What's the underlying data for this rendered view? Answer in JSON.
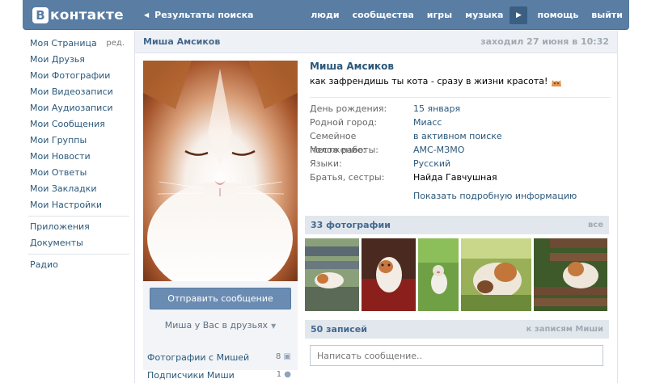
{
  "header": {
    "logo_letter": "В",
    "logo_text": "контакте",
    "back_link": "Результаты поиска",
    "nav": [
      "люди",
      "сообщества",
      "игры",
      "музыка"
    ],
    "nav_after_play": [
      "помощь",
      "выйти"
    ]
  },
  "sidebar": {
    "edit": "ред.",
    "items": [
      "Моя Страница",
      "Мои Друзья",
      "Мои Фотографии",
      "Мои Видеозаписи",
      "Мои Аудиозаписи",
      "Мои Сообщения",
      "Мои Группы",
      "Мои Новости",
      "Мои Ответы",
      "Мои Закладки",
      "Мои Настройки"
    ],
    "extra": [
      "Приложения",
      "Документы"
    ],
    "bottom": [
      "Радио"
    ]
  },
  "profile": {
    "header_name": "Миша Амсиков",
    "last_seen": "заходил 27 июня в 10:32",
    "name": "Миша Амсиков",
    "status": "как зафрендишь ты кота - сразу в жизни красота!",
    "details": [
      {
        "label": "День рождения:",
        "value": "15 января",
        "link": true
      },
      {
        "label": "Родной город:",
        "value": "Миасс",
        "link": true
      },
      {
        "label": "Семейное положение:",
        "value": "в активном поиске",
        "link": true
      },
      {
        "label": "Место работы:",
        "value": "АМС-МЗМО",
        "link": true
      },
      {
        "label": "Языки:",
        "value": "Русский",
        "link": true
      },
      {
        "label": "Братья, сестры:",
        "value": "Найда Гавчушная",
        "link": false
      }
    ],
    "more_info": "Показать подробную информацию",
    "send_message": "Отправить сообщение",
    "friend_status": "Миша у Вас в друзьях",
    "side_links": [
      {
        "label": "Фотографии с Мишей",
        "count": "8"
      },
      {
        "label": "Подписчики Миши",
        "count": "1"
      }
    ]
  },
  "photos": {
    "title": "33 фотографии",
    "all": "все"
  },
  "wall": {
    "title": "50 записей",
    "link": "к записям Миши",
    "placeholder": "Написать сообщение.."
  }
}
